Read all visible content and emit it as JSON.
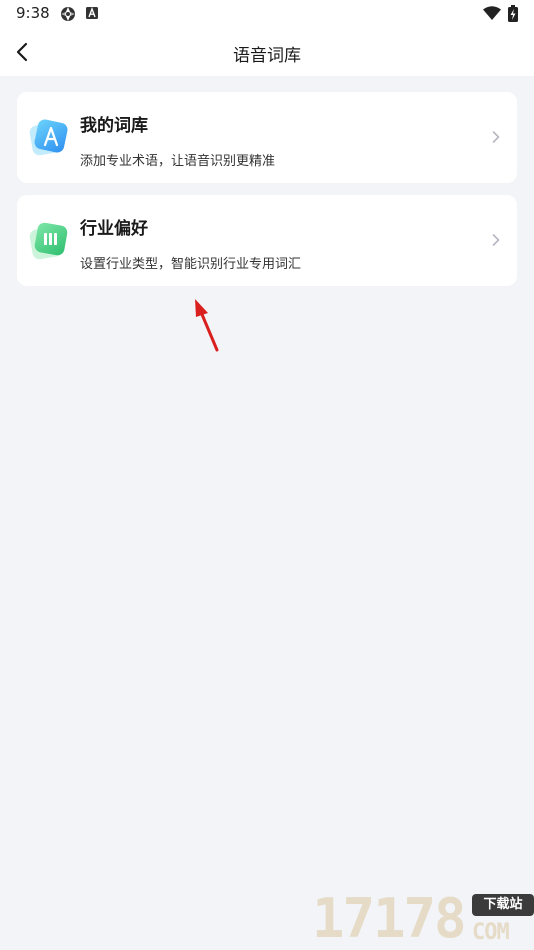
{
  "status_bar": {
    "time": "9:38",
    "notification_icons": [
      "aperture-icon",
      "a-badge-icon"
    ],
    "system_icons": [
      "wifi-icon",
      "battery-charging-icon"
    ]
  },
  "header": {
    "title": "语音词库",
    "back_icon": "chevron-left-icon"
  },
  "cards": [
    {
      "title": "我的词库",
      "description": "添加专业术语，让语音识别更精准",
      "icon": "letter-a-icon",
      "icon_colors": [
        "#56c6f7",
        "#2f8ff0"
      ]
    },
    {
      "title": "行业偏好",
      "description": "设置行业类型，智能识别行业专用词汇",
      "icon": "book-icon",
      "icon_colors": [
        "#6fe0a0",
        "#2fbf6f"
      ]
    }
  ],
  "annotation": {
    "type": "arrow",
    "color": "#d9201e"
  },
  "watermark": {
    "digits": "17178",
    "badge": "下载站",
    "suffix": "COM"
  }
}
